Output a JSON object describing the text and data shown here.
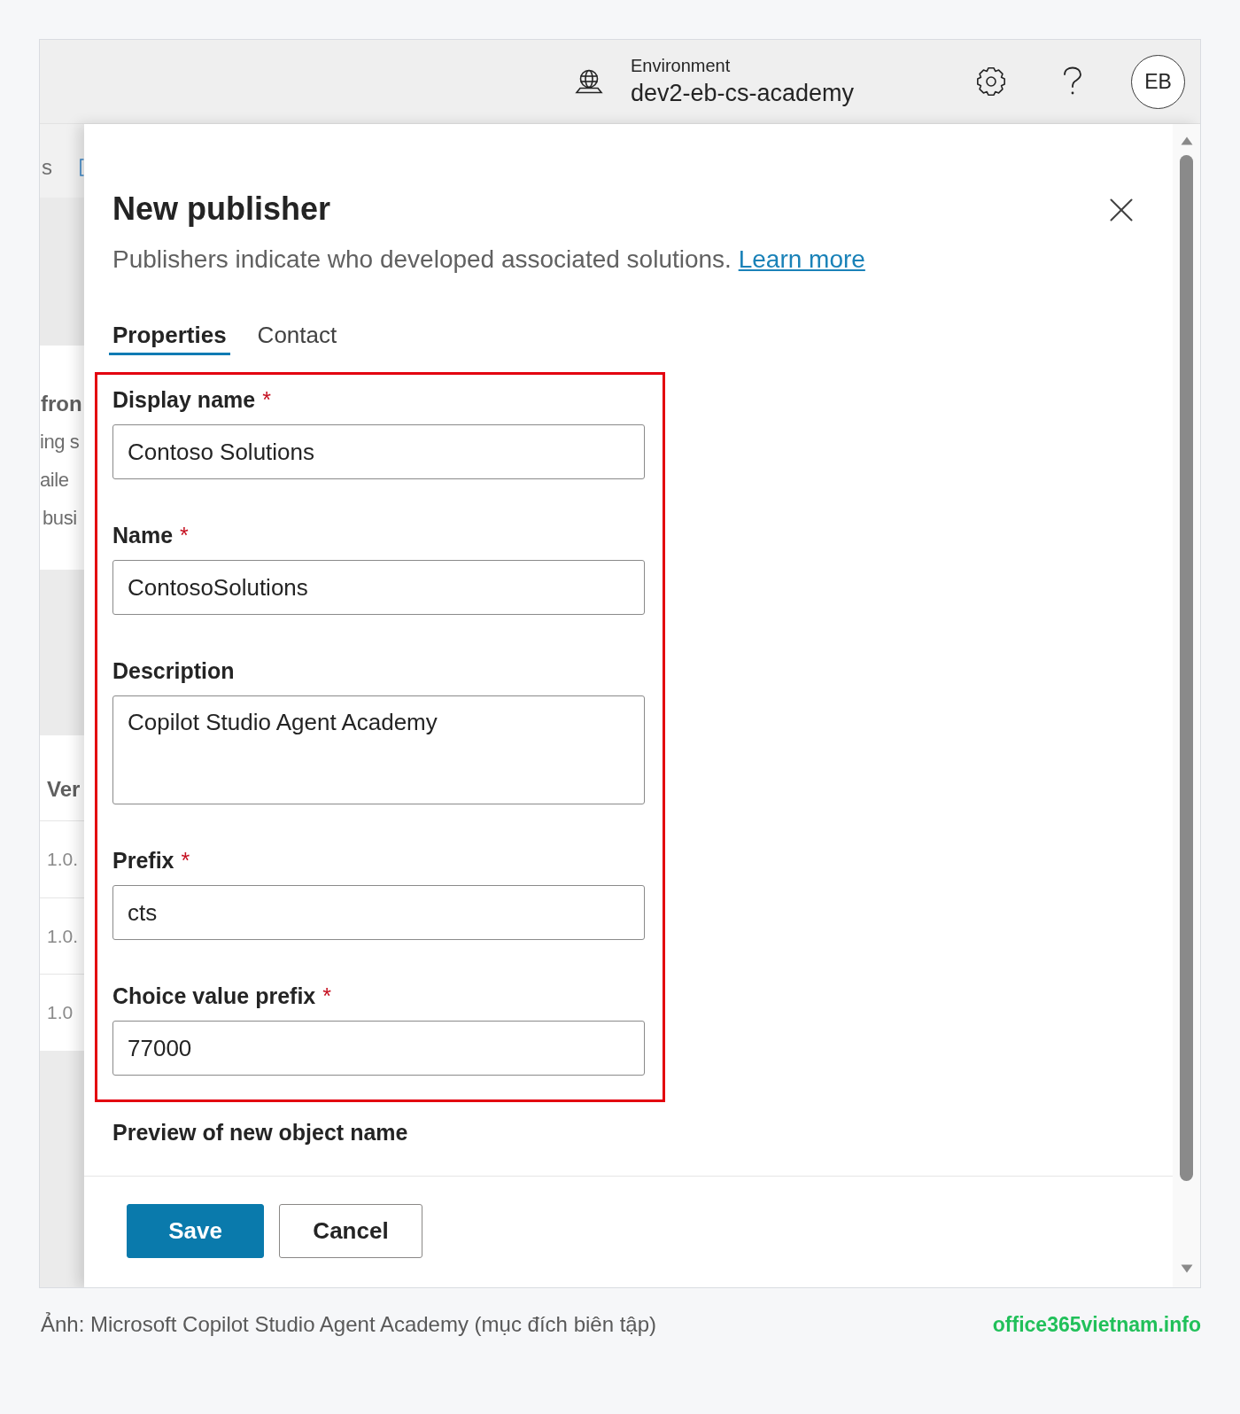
{
  "header": {
    "environment_label": "Environment",
    "environment_name": "dev2-eb-cs-academy",
    "avatar_initials": "EB"
  },
  "background_page": {
    "top_text": "s",
    "card_heading": "fron",
    "card_lines": [
      "ing s",
      "aile",
      "busi"
    ],
    "table_header": "Ver",
    "table_rows": [
      "1.0.",
      "1.0.",
      "1.0"
    ]
  },
  "dialog": {
    "title": "New publisher",
    "description": "Publishers indicate who developed associated solutions.",
    "link": "Learn more",
    "tabs": [
      {
        "label": "Properties",
        "selected": true
      },
      {
        "label": "Contact",
        "selected": false
      }
    ],
    "fields_highlighted": true,
    "fields": [
      {
        "kind": "input",
        "label": "Display name",
        "required_mark": "*",
        "value": "Contoso Solutions"
      },
      {
        "kind": "input",
        "label": "Name",
        "required_mark": "*",
        "value": "ContosoSolutions"
      },
      {
        "kind": "textarea",
        "label": "Description",
        "value": "Copilot Studio Agent Academy"
      },
      {
        "kind": "input",
        "label": "Prefix",
        "required_mark": "*",
        "value": "cts"
      },
      {
        "kind": "input",
        "label": "Choice value prefix",
        "required_mark": "*",
        "value": "77000"
      }
    ],
    "preview_label": "Preview of new object name",
    "buttons": [
      {
        "kind": "primary",
        "label": "Save"
      },
      {
        "kind": "secondary",
        "label": "Cancel"
      }
    ]
  },
  "caption": {
    "text": "Ảnh: Microsoft Copilot Studio Agent Academy (mục đích biên tập)",
    "source": "office365vietnam.info"
  }
}
